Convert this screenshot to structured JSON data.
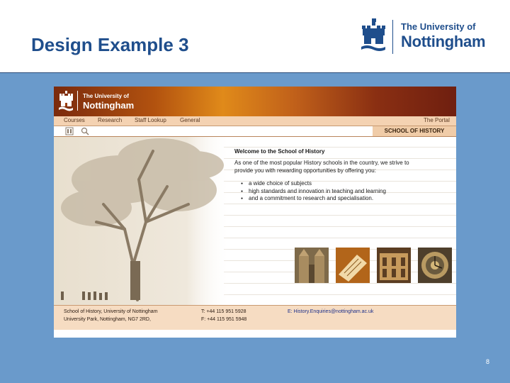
{
  "slide": {
    "title": "Design Example 3",
    "page_number": "8"
  },
  "logo": {
    "line1": "The University of",
    "line2": "Nottingham"
  },
  "site": {
    "logo_line1": "The University of",
    "logo_line2": "Nottingham",
    "nav": [
      "Courses",
      "Research",
      "Staff Lookup",
      "General"
    ],
    "portal": "The Portal",
    "school": "SCHOOL OF HISTORY",
    "welcome_title": "Welcome to the School of History",
    "welcome_text": "As one of the most popular History schools in the country, we strive to provide you with rewarding opportunities by offering you:",
    "bullets": [
      "a wide choice of subjects",
      "high standards and innovation in teaching and learning",
      "and a commitment to research and specialisation."
    ],
    "footer": {
      "address1": "School of History, University of Nottingham",
      "address2": "University Park, Nottingham, NG7 2RD,",
      "tel": "T: +44 115 951 5928",
      "fax": "F: +44 115 951 5948",
      "email": "E: History.Enquiries@nottingham.ac.uk"
    },
    "thumbnails": [
      "cathedral-photo",
      "manuscript-photo",
      "building-photo",
      "clock-photo"
    ]
  },
  "colors": {
    "slide_bg": "#6a9acb",
    "title": "#1f4e8c",
    "banner": "#b2520f"
  }
}
